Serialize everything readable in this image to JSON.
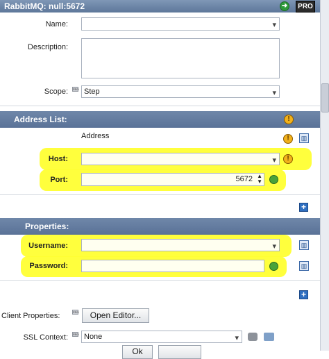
{
  "window": {
    "title": "RabbitMQ: null:5672",
    "pro_badge": "PRO"
  },
  "form": {
    "name_label": "Name:",
    "description_label": "Description:",
    "scope_label": "Scope:",
    "scope_value": "Step",
    "pro_tag": "PRO"
  },
  "address": {
    "section_title": "Address List:",
    "column_header": "Address",
    "host_label": "Host:",
    "port_label": "Port:",
    "port_value": "5672"
  },
  "properties": {
    "section_title": "Properties:",
    "username_label": "Username:",
    "password_label": "Password:"
  },
  "client": {
    "client_properties_label": "Client Properties:",
    "open_editor_label": "Open Editor...",
    "ssl_context_label": "SSL Context:",
    "ssl_context_value": "None"
  },
  "footer": {
    "ok_label": "Ok"
  },
  "colors": {
    "highlight": "#ffff33",
    "section_header": "#5f789b",
    "warning": "#f2b21b",
    "gear": "#49a23a"
  },
  "icons": [
    "go-arrow-icon",
    "warning-icon",
    "trash-icon",
    "add-icon",
    "gear-icon",
    "pro-tag-icon",
    "chevron-down-icon"
  ]
}
